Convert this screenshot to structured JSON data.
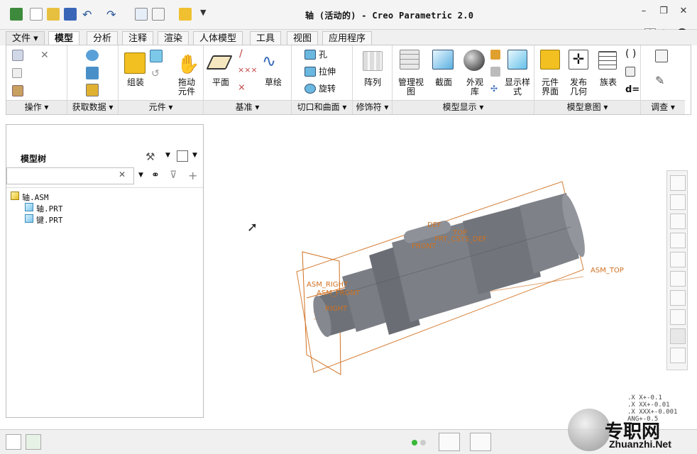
{
  "window": {
    "title": "轴 (活动的) - Creo Parametric 2.0",
    "controls": [
      "minimize-icon",
      "restore-icon",
      "close-icon"
    ]
  },
  "tabs": [
    {
      "label": "文件",
      "has_menu": true
    },
    {
      "label": "模型",
      "active": true
    },
    {
      "label": "分析"
    },
    {
      "label": "注释"
    },
    {
      "label": "渲染"
    },
    {
      "label": "人体模型"
    },
    {
      "label": "工具"
    },
    {
      "label": "视图"
    },
    {
      "label": "应用程序"
    }
  ],
  "ribbon": {
    "groups": [
      "操作",
      "获取数据",
      "元件",
      "基准",
      "切口和曲面",
      "修饰符",
      "模型显示",
      "模型意图",
      "调查"
    ],
    "buttons": {
      "assemble": "组装",
      "drag": "拖动\n元件",
      "plane": "平面",
      "sketch": "草绘",
      "hole": "孔",
      "extrude": "拉伸",
      "revolve": "旋转",
      "pattern": "阵列",
      "manage_views": "管理视\n图",
      "section": "截面",
      "appearance": "外观\n库",
      "display_style": "显示样\n式",
      "component_interface": "元件\n界面",
      "publish_geometry": "发布\n几何",
      "family_table": "族表",
      "d_equals": "d="
    },
    "accent_color": "#f2a000"
  },
  "left_panel": {
    "title": "模型树",
    "search_placeholder": "",
    "tree": [
      {
        "label": "轴.ASM",
        "level": 0,
        "type": "asm"
      },
      {
        "label": "轴.PRT",
        "level": 1,
        "type": "prt"
      },
      {
        "label": "键.PRT",
        "level": 1,
        "type": "prt"
      }
    ]
  },
  "viewport": {
    "datum_labels": [
      "ASM_TOP",
      "ASM_RIGHT",
      "ASM_FRONT",
      "PRT_CSYS_DEF",
      "TOP",
      "RIGHT",
      "FRONT",
      "DEF"
    ],
    "tolerance_lines": [
      ".X X+-0.1",
      ".X XX+-0.01",
      ".X XXX+-0.001",
      "ANG+-0.5"
    ],
    "datum_color": "#d07020",
    "model_color": "#6e7278"
  },
  "watermark": {
    "brand": "专职网",
    "url": "Zhuanzhi.Net"
  }
}
